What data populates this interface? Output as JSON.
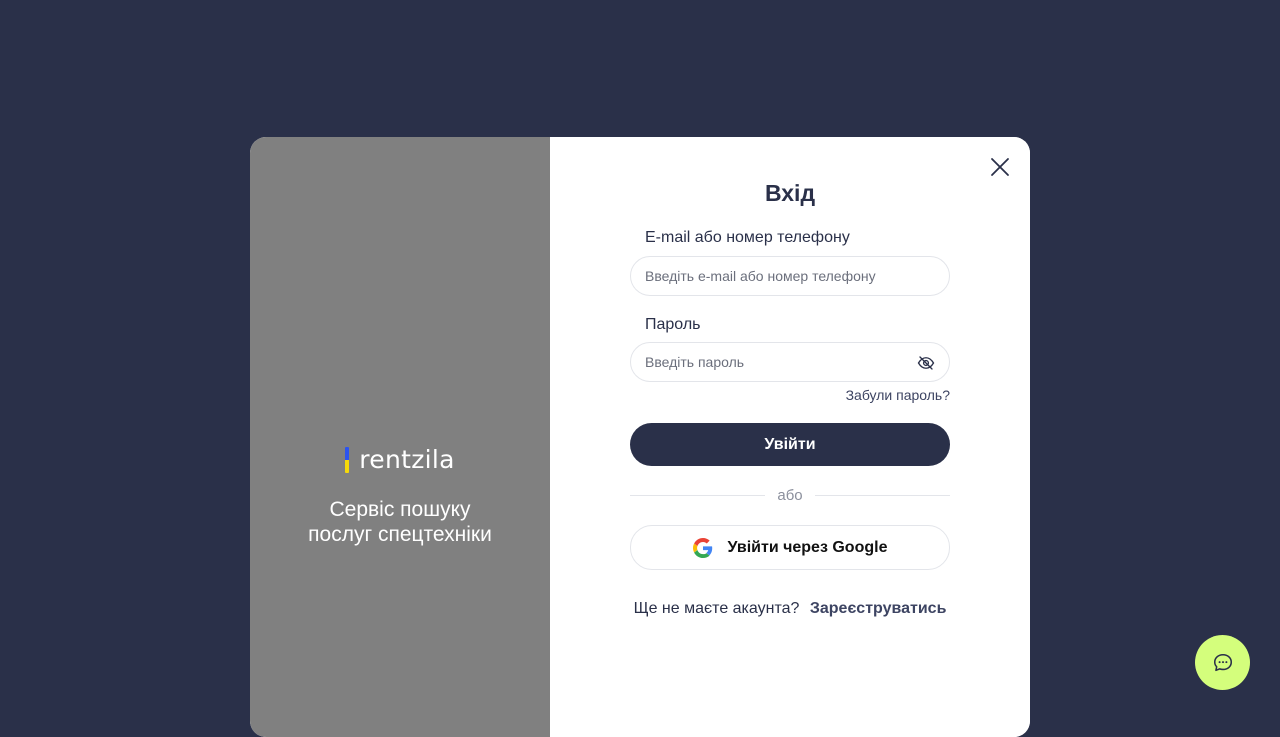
{
  "brand": {
    "name": "rentzila",
    "tagline_line1": "Сервіс пошуку",
    "tagline_line2": "послуг спецтехніки",
    "flag_colors": [
      "#2b54f0",
      "#f5d90a"
    ]
  },
  "login": {
    "title": "Вхід",
    "email_label": "E-mail або номер телефону",
    "email_placeholder": "Введіть e-mail або номер телефону",
    "email_value": "",
    "password_label": "Пароль",
    "password_placeholder": "Введіть пароль",
    "password_value": "",
    "forgot_password": "Забули пароль?",
    "submit_label": "Увійти",
    "or_text": "або",
    "google_label": "Увійти через Google",
    "no_account_text": "Ще не маєте акаунта?",
    "register_link": "Зареєструватись"
  },
  "icons": {
    "close": "close-icon",
    "password_toggle": "eye-off-icon",
    "google": "google-icon",
    "chat": "chat-bubble-icon"
  },
  "colors": {
    "background": "#2a3049",
    "left_panel": "#808080",
    "primary": "#2a3049",
    "chat_accent": "#d4fe7c"
  }
}
